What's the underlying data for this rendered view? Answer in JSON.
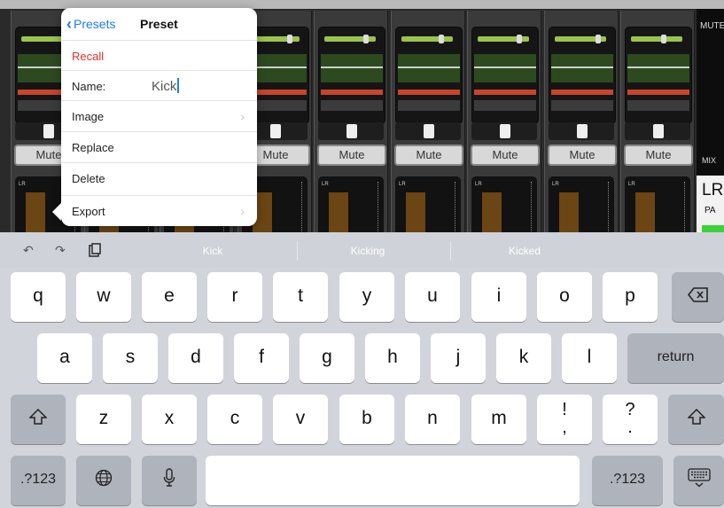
{
  "mixer": {
    "mute_label": "Mute",
    "right_panel": {
      "mute": "MUTE",
      "mix": "MIX",
      "lr": "LR",
      "pa": "PA"
    }
  },
  "popover": {
    "back_label": "Presets",
    "title": "Preset",
    "recall": "Recall",
    "name_label": "Name:",
    "name_value": "Kick",
    "image": "Image",
    "replace": "Replace",
    "delete": "Delete",
    "export": "Export"
  },
  "suggestions": [
    "Kick",
    "Kicking",
    "Kicked"
  ],
  "keyboard": {
    "row1": [
      "q",
      "w",
      "e",
      "r",
      "t",
      "y",
      "u",
      "i",
      "o",
      "p"
    ],
    "row2": [
      "a",
      "s",
      "d",
      "f",
      "g",
      "h",
      "j",
      "k",
      "l"
    ],
    "row3": [
      "z",
      "x",
      "c",
      "v",
      "b",
      "n",
      "m"
    ],
    "punct1": [
      "!",
      ","
    ],
    "punct2": [
      "?",
      "."
    ],
    "return": "return",
    "numbers": ".?123",
    "icons": {
      "backspace": "backspace-icon",
      "shift": "shift-icon",
      "globe": "globe-icon",
      "mic": "microphone-icon",
      "dismiss": "keyboard-dismiss-icon",
      "undo": "undo-icon",
      "redo": "redo-icon",
      "paste": "paste-icon"
    }
  },
  "colors": {
    "accent": "#1e7cf4",
    "destructive": "#e0302a"
  }
}
